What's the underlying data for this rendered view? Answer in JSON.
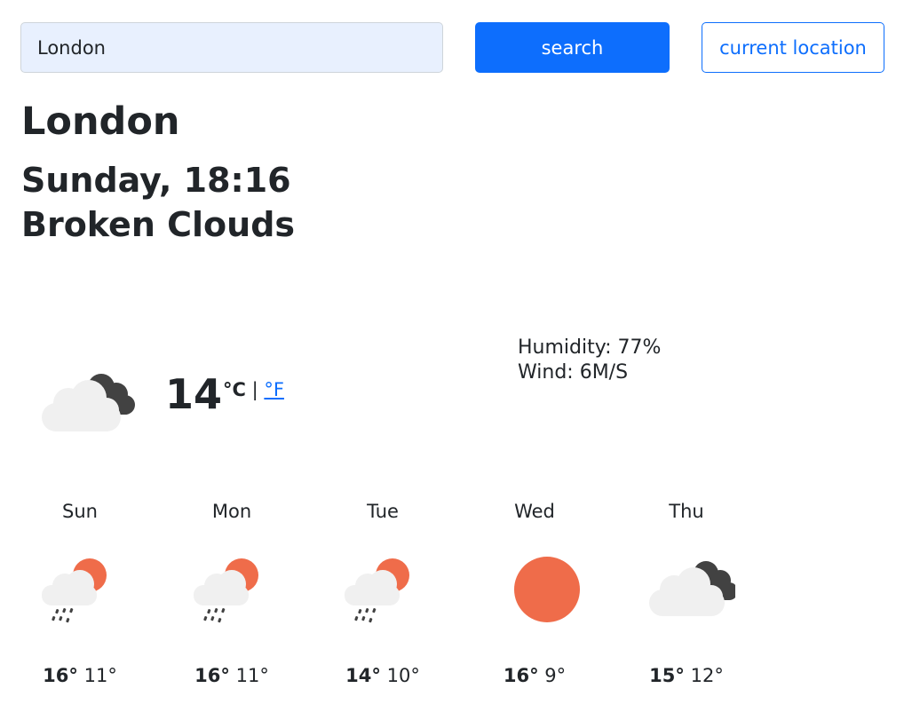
{
  "search": {
    "value": "London",
    "button_label": "search",
    "location_label": "current location"
  },
  "weather": {
    "city": "London",
    "datetime": "Sunday, 18:16",
    "description": "Broken Clouds",
    "temperature": "14",
    "unit_celsius": "°C",
    "unit_separator": "|",
    "unit_fahrenheit": "°F",
    "humidity": "Humidity: 77%",
    "wind": "Wind: 6M/S",
    "icon": "broken-clouds-icon"
  },
  "forecast": [
    {
      "day": "Sun",
      "max": "16°",
      "min": "11°",
      "icon": "rain-sun-cloud-icon"
    },
    {
      "day": "Mon",
      "max": "16°",
      "min": "11°",
      "icon": "rain-sun-cloud-icon"
    },
    {
      "day": "Tue",
      "max": "14°",
      "min": "10°",
      "icon": "rain-sun-cloud-icon"
    },
    {
      "day": "Wed",
      "max": "16°",
      "min": "9°",
      "icon": "sun-icon"
    },
    {
      "day": "Thu",
      "max": "15°",
      "min": "12°",
      "icon": "broken-clouds-icon"
    }
  ],
  "colors": {
    "accent": "#0d6efd",
    "sun": "#ef6c4a",
    "cloud": "#f0f0f0",
    "dark_cloud": "#424242"
  }
}
